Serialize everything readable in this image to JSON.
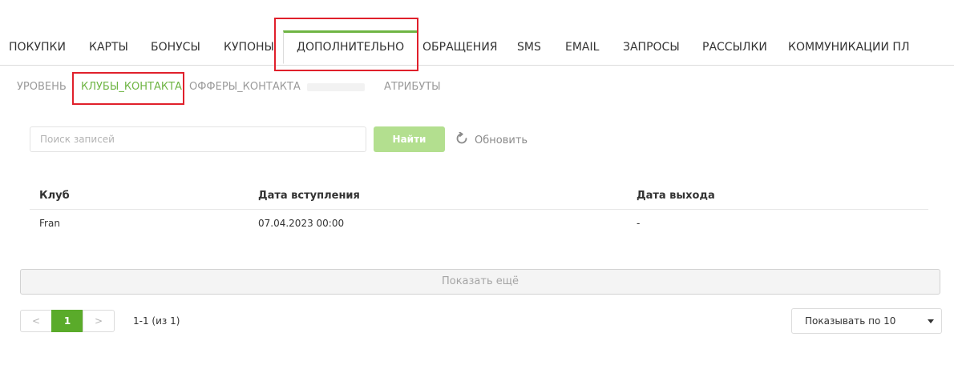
{
  "main_tabs": [
    {
      "label": "ПОКУПКИ"
    },
    {
      "label": "КАРТЫ"
    },
    {
      "label": "БОНУСЫ"
    },
    {
      "label": "КУПОНЫ"
    },
    {
      "label": "ДОПОЛНИТЕЛЬНО",
      "active": true
    },
    {
      "label": "ОБРАЩЕНИЯ"
    },
    {
      "label": "SMS"
    },
    {
      "label": "EMAIL"
    },
    {
      "label": "ЗАПРОСЫ"
    },
    {
      "label": "РАССЫЛКИ"
    },
    {
      "label": "КОММУНИКАЦИИ ПЛ"
    }
  ],
  "sub_tabs": [
    {
      "label": "УРОВЕНЬ"
    },
    {
      "label": "КЛУБЫ_КОНТАКТА",
      "active": true
    },
    {
      "label": "ОФФЕРЫ_КОНТАКТА"
    },
    {
      "label": "АТРИБУТЫ"
    }
  ],
  "search": {
    "placeholder": "Поиск записей",
    "value": "",
    "find_label": "Найти",
    "refresh_label": "Обновить"
  },
  "table": {
    "headers": [
      "Клуб",
      "Дата вступления",
      "Дата выхода"
    ],
    "rows": [
      [
        "Fran",
        "07.04.2023 00:00",
        "-"
      ]
    ]
  },
  "show_more_label": "Показать ещё",
  "pagination": {
    "prev": "<",
    "current": "1",
    "next": ">",
    "range_text": "1-1 (из 1)"
  },
  "page_size": {
    "selected": "Показывать по 10"
  },
  "colors": {
    "accent": "#6fb544",
    "highlight": "#e0202b",
    "find_button": "#b3df8f",
    "active_page": "#5aab2a"
  }
}
